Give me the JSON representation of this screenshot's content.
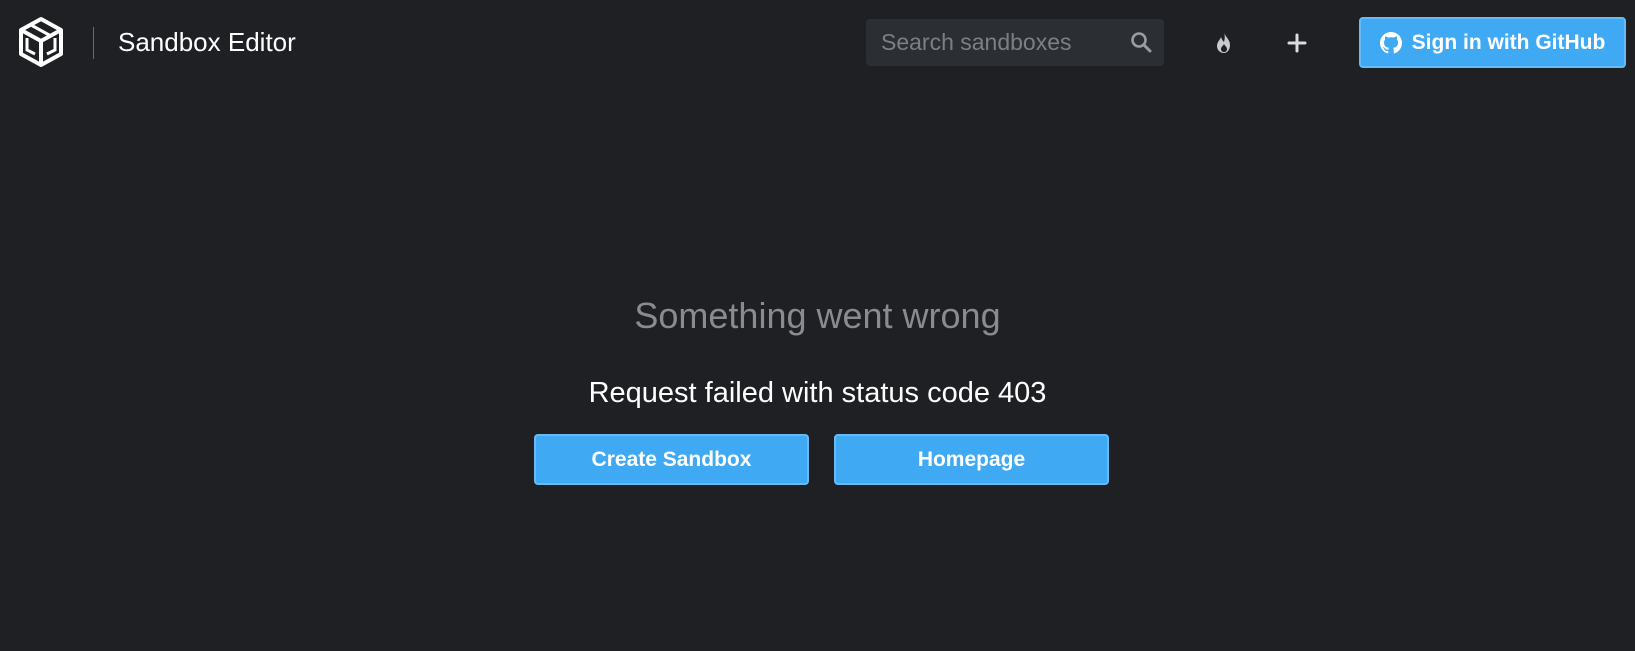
{
  "header": {
    "logo_icon": "codesandbox-cube-icon",
    "title": "Sandbox Editor",
    "search": {
      "placeholder": "Search sandboxes",
      "value": ""
    },
    "search_icon": "search-icon",
    "flame_icon": "flame-icon",
    "plus_icon": "plus-icon",
    "signin": {
      "label": "Sign in with GitHub",
      "icon": "github-icon"
    }
  },
  "error": {
    "title": "Something went wrong",
    "message": "Request failed with status code 403"
  },
  "actions": {
    "create_label": "Create Sandbox",
    "home_label": "Homepage"
  },
  "colors": {
    "background": "#1e2024",
    "accent": "#40a9f3",
    "search_bg": "#2b2e33",
    "muted_text": "#8a8b8f"
  }
}
